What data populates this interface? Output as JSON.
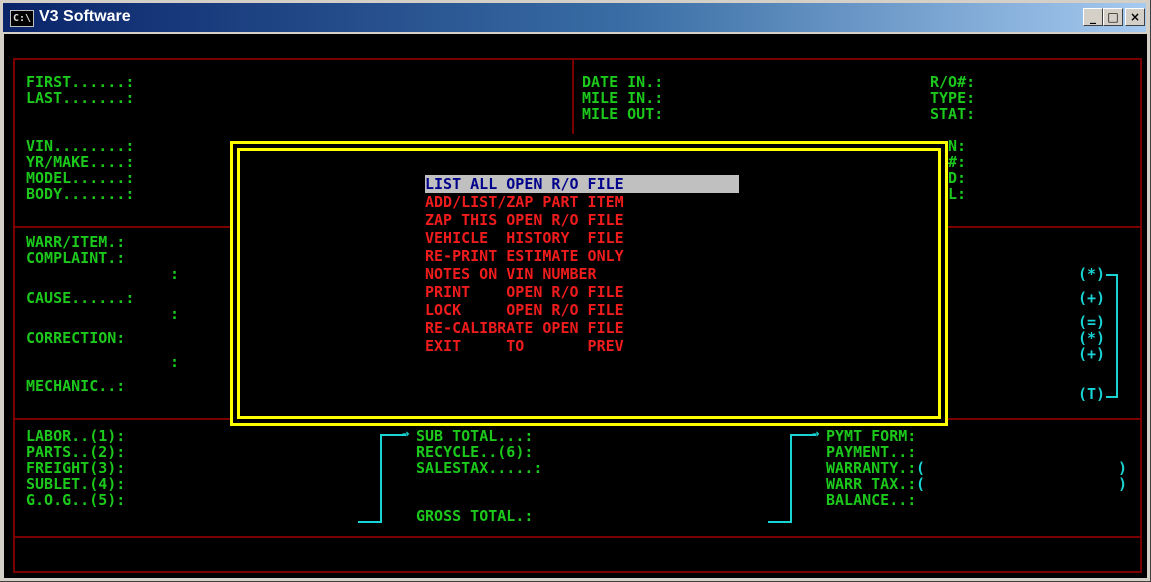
{
  "window": {
    "icon_text": "C:\\",
    "title": "V3 Software",
    "min_label": "_",
    "max_label": "□",
    "close_label": "×"
  },
  "vehicle": {
    "first": "FIRST......:",
    "last": "LAST.......:",
    "vin": "VIN........:",
    "yrmake": "YR/MAKE....:",
    "model": "MODEL......:",
    "body": "BODY.......:"
  },
  "dates": {
    "date_in": "DATE IN.:",
    "mile_in": "MILE IN.:",
    "mile_out": "MILE OUT:"
  },
  "ro": {
    "ro_num": "R/O#:",
    "type": "TYPE:",
    "stat": "STAT:",
    "partial_n": "N:",
    "partial_hash": "#:",
    "partial_d": "D:",
    "partial_l": "L:"
  },
  "work": {
    "warr_item": "WARR/ITEM.:",
    "complaint": "COMPLAINT.:",
    "complaint_cont": ":",
    "cause": "CAUSE......:",
    "cause_cont": ":",
    "correction": "CORRECTION:",
    "correction_cont": ":",
    "mechanic": "MECHANIC..:"
  },
  "side_markers": [
    "(*)",
    "(+)",
    "(=)",
    "(*)",
    "(+)",
    "(T)"
  ],
  "totals_left": {
    "labor": "LABOR..(1):",
    "parts": "PARTS..(2):",
    "freight": "FREIGHT(3):",
    "sublet": "SUBLET.(4):",
    "gog": "G.O.G..(5):"
  },
  "totals_mid": {
    "sub_total": "SUB TOTAL...:",
    "recycle": "RECYCLE..(6):",
    "salestax": "SALESTAX.....:",
    "gross_total": "GROSS TOTAL.:"
  },
  "totals_right": {
    "pymt_form": "PYMT FORM:",
    "payment": "PAYMENT..:",
    "warranty": "WARRANTY.:",
    "warr_tax": "WARR TAX.:",
    "balance": "BALANCE..:",
    "open_paren": "(",
    "close_paren": ")"
  },
  "menu": {
    "items": [
      "LIST ALL OPEN R/O FILE",
      "ADD/LIST/ZAP PART ITEM",
      "ZAP THIS OPEN R/O FILE",
      "VEHICLE  HISTORY  FILE",
      "RE-PRINT ESTIMATE ONLY",
      "NOTES ON VIN NUMBER",
      "PRINT    OPEN R/O FILE",
      "LOCK     OPEN R/O FILE",
      "RE-CALIBRATE OPEN FILE",
      "EXIT     TO       PREV"
    ],
    "selected_index": 0
  },
  "colors": {
    "label_green": "#1cc81c",
    "menu_red": "#ee1c1c",
    "frame_red": "#7a0000",
    "popup_yellow": "#ffff00",
    "accent_cyan": "#19d4d4",
    "selection_bg": "#c0c0c0",
    "selection_fg": "#00008b"
  }
}
